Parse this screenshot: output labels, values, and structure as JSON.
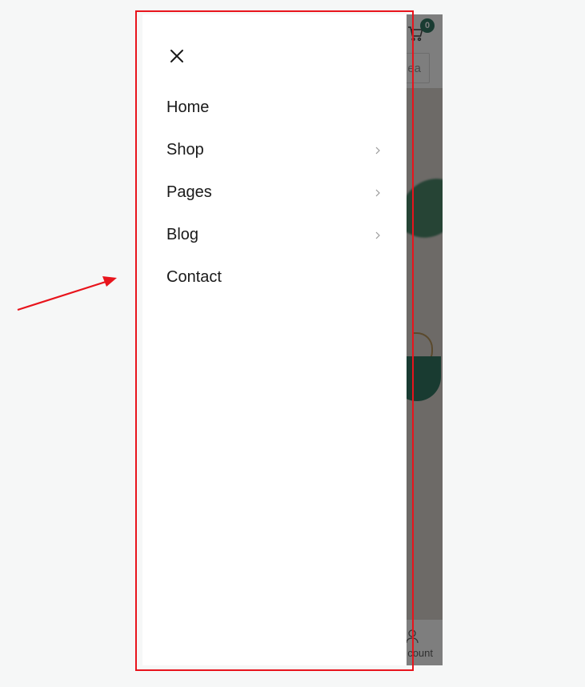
{
  "header": {
    "cart_count": "0",
    "search_partial": "ea"
  },
  "bottom_nav": {
    "account_partial": "count"
  },
  "drawer": {
    "close_icon": "close-icon",
    "menu": [
      {
        "label": "Home",
        "has_submenu": false
      },
      {
        "label": "Shop",
        "has_submenu": true
      },
      {
        "label": "Pages",
        "has_submenu": true
      },
      {
        "label": "Blog",
        "has_submenu": true
      },
      {
        "label": "Contact",
        "has_submenu": false
      }
    ]
  },
  "annotation": {
    "frame_color": "#e8141c",
    "arrow_color": "#e8141c"
  },
  "colors": {
    "accent": "#1f6b54",
    "text": "#1a1a1a",
    "chevron": "#9a9a9a"
  }
}
